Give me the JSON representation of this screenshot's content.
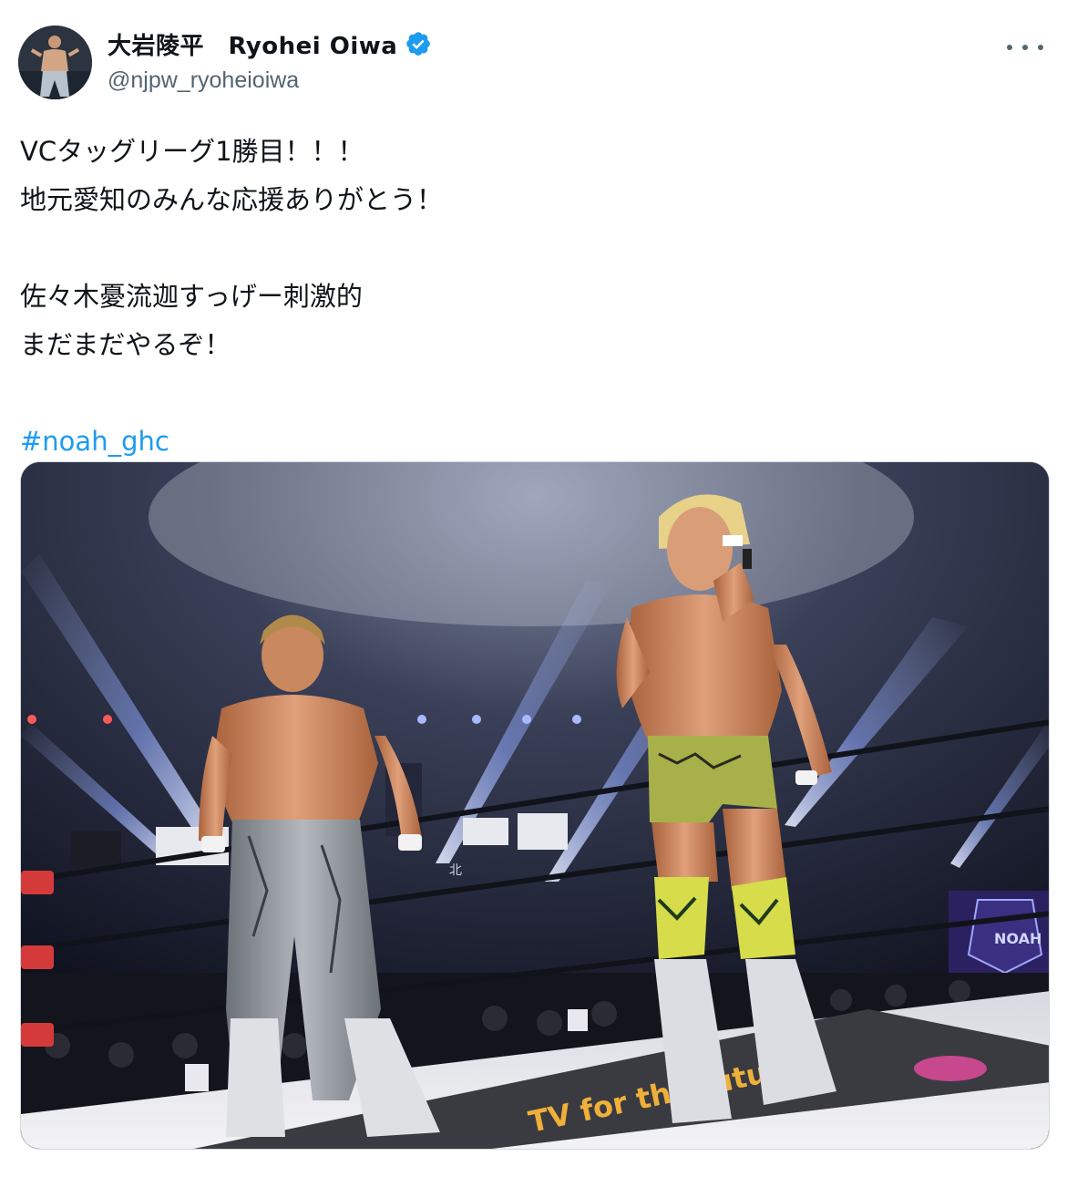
{
  "author": {
    "display_name": "大岩陵平　Ryohei Oiwa",
    "handle": "@njpw_ryoheioiwa",
    "verified": true,
    "avatar_icon": "profile-photo"
  },
  "menu": {
    "icon": "more-dots-icon"
  },
  "tweet": {
    "lines": [
      "VCタッグリーグ1勝目！！！",
      "地元愛知のみんな応援ありがとう！",
      "",
      "佐々木憂流迦すっげー刺激的",
      "まだまだやるぞ！",
      ""
    ],
    "hashtag": "#noah_ghc"
  },
  "media": {
    "type": "photo",
    "description_icon": "wrestling-ring-photo",
    "signage": {
      "noah": "NOAH",
      "mat_text": "TV for the future",
      "floor_sign": "北"
    }
  },
  "colors": {
    "link": "#1d9bf0",
    "verified": "#1d9bf0",
    "secondary_text": "#536471"
  }
}
